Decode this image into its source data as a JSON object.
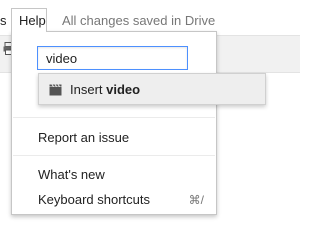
{
  "menubar": {
    "prev_menu_fragment": "s",
    "help_label": "Help",
    "save_status": "All changes saved in Drive"
  },
  "help_menu": {
    "search": {
      "value": "video"
    },
    "suggestion": {
      "icon": "video-clapper-icon",
      "prefix": "Insert ",
      "match": "video"
    },
    "items": [
      {
        "label": "Report an issue"
      },
      {
        "label": "What's new"
      },
      {
        "label": "Keyboard shortcuts",
        "shortcut": "⌘/"
      }
    ]
  },
  "colors": {
    "focus_border": "#4d90fe",
    "suggestion_bg": "#eeeeee",
    "toolbar_bg": "#f1f1f1"
  }
}
